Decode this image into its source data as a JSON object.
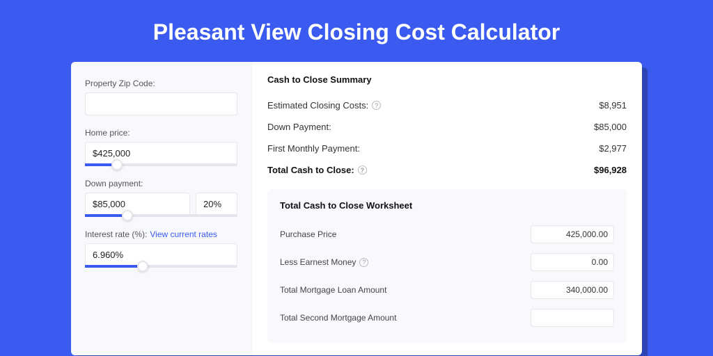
{
  "title": "Pleasant View Closing Cost Calculator",
  "inputs": {
    "zip": {
      "label": "Property Zip Code:",
      "value": ""
    },
    "home_price": {
      "label": "Home price:",
      "value": "$425,000",
      "slider_pct": 21
    },
    "down_payment": {
      "label": "Down payment:",
      "value": "$85,000",
      "pct": "20%",
      "slider_pct": 28
    },
    "interest_rate": {
      "label": "Interest rate (%):",
      "link_text": "View current rates",
      "value": "6.960%",
      "slider_pct": 38
    }
  },
  "summary": {
    "title": "Cash to Close Summary",
    "rows": [
      {
        "label": "Estimated Closing Costs:",
        "help": true,
        "value": "$8,951"
      },
      {
        "label": "Down Payment:",
        "help": false,
        "value": "$85,000"
      },
      {
        "label": "First Monthly Payment:",
        "help": false,
        "value": "$2,977"
      }
    ],
    "total": {
      "label": "Total Cash to Close:",
      "help": true,
      "value": "$96,928"
    }
  },
  "worksheet": {
    "title": "Total Cash to Close Worksheet",
    "rows": [
      {
        "label": "Purchase Price",
        "help": false,
        "value": "425,000.00"
      },
      {
        "label": "Less Earnest Money",
        "help": true,
        "value": "0.00"
      },
      {
        "label": "Total Mortgage Loan Amount",
        "help": false,
        "value": "340,000.00"
      },
      {
        "label": "Total Second Mortgage Amount",
        "help": false,
        "value": ""
      }
    ]
  }
}
